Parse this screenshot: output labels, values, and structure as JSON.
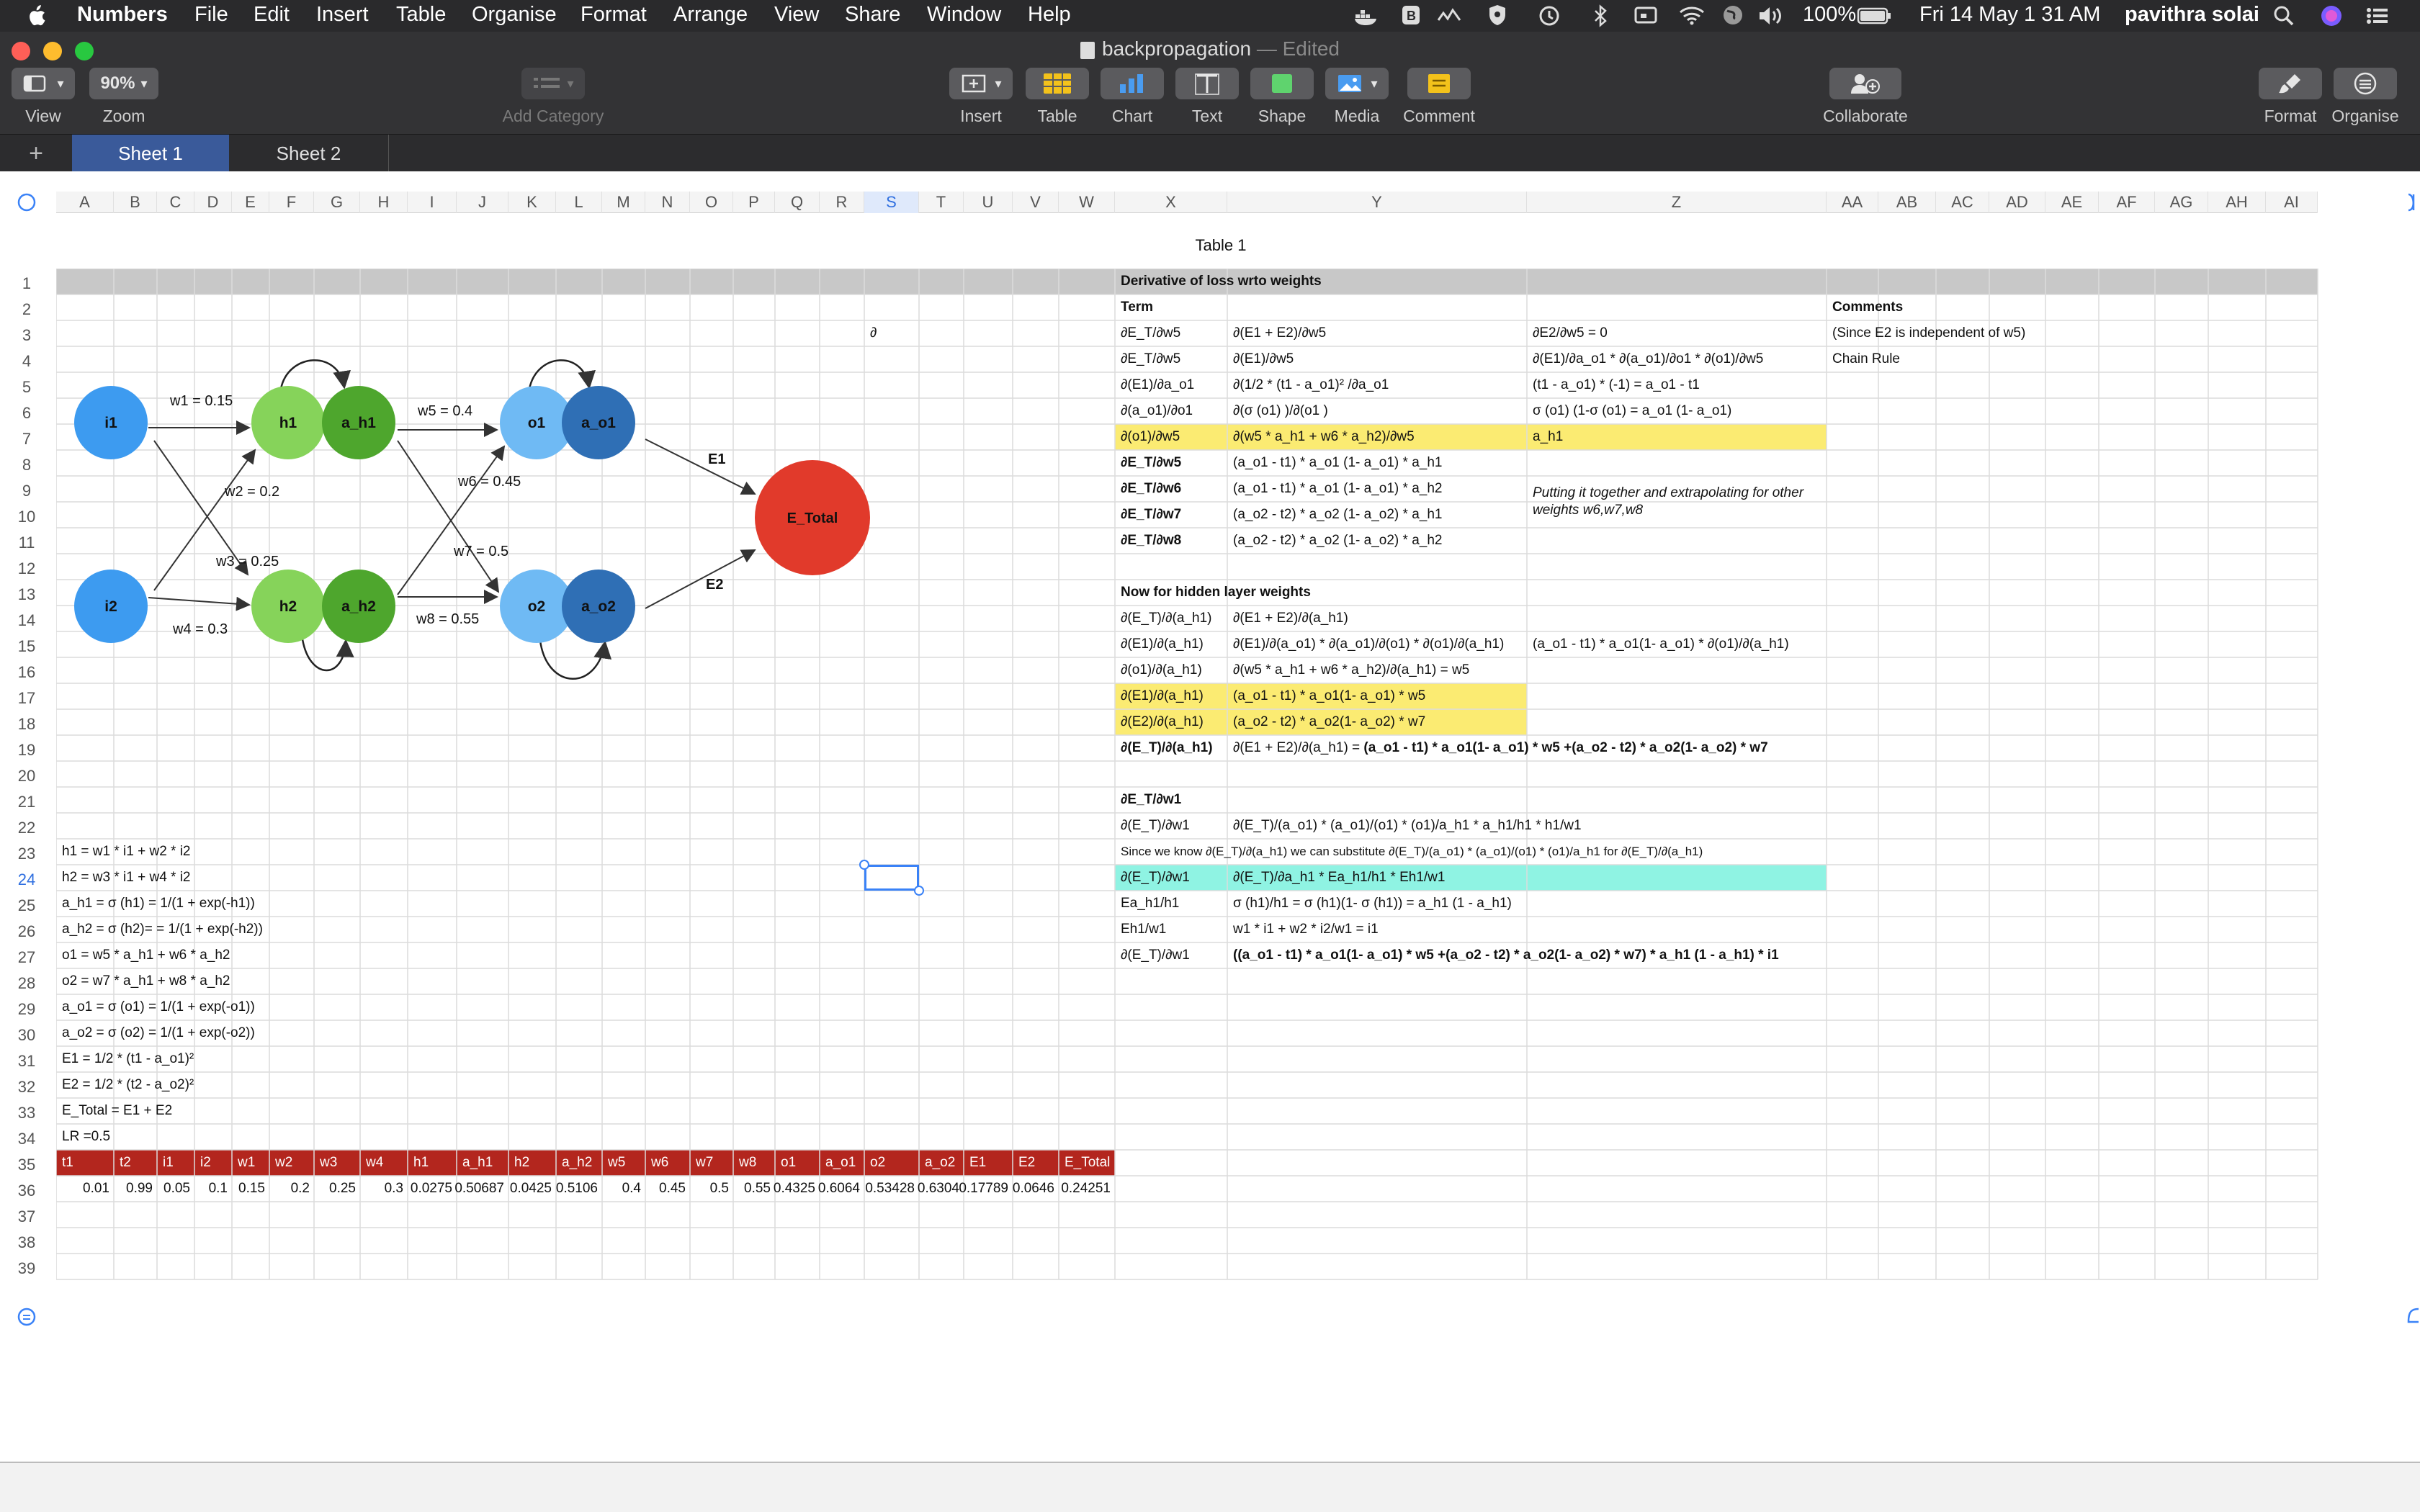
{
  "menubar": {
    "apple": "",
    "items": [
      "Numbers",
      "File",
      "Edit",
      "Insert",
      "Table",
      "Organise",
      "Format",
      "Arrange",
      "View",
      "Share",
      "Window",
      "Help"
    ],
    "battery": "100%",
    "datetime": "Fri 14 May  1 31 AM",
    "user": "pavithra solai"
  },
  "document": {
    "title": "backpropagation",
    "edited": "— Edited"
  },
  "toolbar": {
    "view": "View",
    "zoom": "Zoom",
    "zoom_value": "90%",
    "add_category": "Add Category",
    "insert": "Insert",
    "table": "Table",
    "chart": "Chart",
    "text": "Text",
    "shape": "Shape",
    "media": "Media",
    "comment": "Comment",
    "collaborate": "Collaborate",
    "format": "Format",
    "organise": "Organise"
  },
  "sheets": {
    "add": "+",
    "tabs": [
      "Sheet 1",
      "Sheet 2"
    ],
    "active": 0
  },
  "table": {
    "title": "Table 1",
    "columns": [
      "A",
      "B",
      "C",
      "D",
      "E",
      "F",
      "G",
      "H",
      "I",
      "J",
      "K",
      "L",
      "M",
      "N",
      "O",
      "P",
      "Q",
      "R",
      "S",
      "T",
      "U",
      "V",
      "W",
      "X",
      "Y",
      "Z",
      "AA",
      "AB",
      "AC",
      "AD",
      "AE",
      "AF",
      "AG",
      "AH",
      "AI"
    ],
    "rows": 39,
    "selected_column": "S",
    "selected_row": 24
  },
  "diagram": {
    "nodes": [
      "i1",
      "i2",
      "h1",
      "a_h1",
      "h2",
      "a_h2",
      "o1",
      "a_o1",
      "o2",
      "a_o2",
      "E_Total"
    ],
    "weights": [
      "w1 = 0.15",
      "w2 = 0.2",
      "w3 = 0.25",
      "w4 = 0.3",
      "w5 = 0.4",
      "w6 = 0.45",
      "w7 = 0.5",
      "w8 = 0.55"
    ],
    "errors": [
      "E1",
      "E2"
    ],
    "colors": {
      "input": "#3d9bf0",
      "hidden": "#86d35a",
      "hidden_act": "#4ea62d",
      "output": "#6fbaf4",
      "output_act": "#2f6fb5",
      "error": "#e13a2b"
    }
  },
  "cells": {
    "s3": "∂",
    "x1": "Derivative of loss wrto weights",
    "x2": "Term",
    "aa2": "Comments",
    "x3": "∂E_T/∂w5",
    "y3": "∂(E1 + E2)/∂w5",
    "z3": "∂E2/∂w5 = 0",
    "aa3": "(Since E2 is independent of w5)",
    "x4": "∂E_T/∂w5",
    "y4": "∂(E1)/∂w5",
    "z4": "∂(E1)/∂a_o1 * ∂(a_o1)/∂o1 * ∂(o1)/∂w5",
    "aa4": "Chain Rule",
    "x5": "∂(E1)/∂a_o1",
    "y5": "∂(1/2 * (t1 - a_o1)² /∂a_o1",
    "z5": "(t1 - a_o1) * (-1) = a_o1 - t1",
    "x6": "∂(a_o1)/∂o1",
    "y6": "∂(σ (o1) )/∂(o1 )",
    "z6": "σ (o1) (1-σ (o1)  = a_o1 (1- a_o1)",
    "x7": "∂(o1)/∂w5",
    "y7": "∂(w5 * a_h1  + w6 * a_h2)/∂w5",
    "z7": "a_h1",
    "x8": "∂E_T/∂w5",
    "y8": "(a_o1 - t1) * a_o1 (1- a_o1) * a_h1",
    "x9": "∂E_T/∂w6",
    "y9": "(a_o1 - t1) * a_o1 (1- a_o1) * a_h2",
    "z9": "Putting it together and extrapolating for other weights w6,w7,w8",
    "x10": "∂E_T/∂w7",
    "y10": "(a_o2 - t2) * a_o2 (1- a_o2) * a_h1",
    "x11": "∂E_T/∂w8",
    "y11": "(a_o2 - t2) * a_o2 (1- a_o2) * a_h2",
    "x13": "Now for hidden layer weights",
    "x14": "∂(E_T)/∂(a_h1)",
    "y14": "∂(E1 + E2)/∂(a_h1)",
    "x15": "∂(E1)/∂(a_h1)",
    "y15": "∂(E1)/∂(a_o1) * ∂(a_o1)/∂(o1) * ∂(o1)/∂(a_h1)",
    "z15": "(a_o1 - t1) * a_o1(1- a_o1) * ∂(o1)/∂(a_h1)",
    "x16": "∂(o1)/∂(a_h1)",
    "y16": "∂(w5 * a_h1  + w6 * a_h2)/∂(a_h1) = w5",
    "x17": "∂(E1)/∂(a_h1)",
    "y17": "(a_o1 - t1) * a_o1(1- a_o1) * w5",
    "x18": "∂(E2)/∂(a_h1)",
    "y18": "(a_o2 - t2) * a_o2(1- a_o2) * w7",
    "x19": "∂(E_T)/∂(a_h1)",
    "y19a": "∂(E1 + E2)/∂(a_h1) = ",
    "y19b": "(a_o1 - t1) * a_o1(1- a_o1) * w5 +(a_o2 - t2) * a_o2(1- a_o2) * w7",
    "x21": "∂E_T/∂w1",
    "x22": "∂(E_T)/∂w1",
    "y22": "∂(E_T)/(a_o1) *  (a_o1)/(o1)  * (o1)/a_h1 * a_h1/h1 * h1/w1",
    "x23": "Since we know ∂(E_T)/∂(a_h1) we can substitute ∂(E_T)/(a_o1) *  (a_o1)/(o1)  * (o1)/a_h1  for ∂(E_T)/∂(a_h1)",
    "x24": "∂(E_T)/∂w1",
    "y24": "∂(E_T)/∂a_h1 * Ea_h1/h1 * Eh1/w1",
    "x25": "Ea_h1/h1",
    "y25": "σ (h1)/h1 = σ (h1)(1- σ (h1)) = a_h1 (1 - a_h1)",
    "x26": "Eh1/w1",
    "y26": "w1 * i1 + w2 * i2/w1 = i1",
    "x27": "∂(E_T)/∂w1",
    "y27": "((a_o1 - t1) * a_o1(1- a_o1) * w5 +(a_o2 - t2) * a_o2(1- a_o2) * w7) * a_h1 (1 - a_h1) * i1",
    "a23": "h1 = w1 * i1 + w2 * i2",
    "a24": "h2 = w3 * i1 + w4 * i2",
    "a25": "a_h1 = σ (h1) = 1/(1 + exp(-h1))",
    "a26": "a_h2 = σ (h2)= = 1/(1 + exp(-h2))",
    "a27": "o1 = w5 * a_h1  + w6 * a_h2",
    "a28": "o2 = w7 * a_h1  + w8 * a_h2",
    "a29": "a_o1 = σ (o1) = 1/(1 + exp(-o1))",
    "a30": "a_o2 = σ (o2) = 1/(1 + exp(-o2))",
    "a31": "E1 = 1/2 * (t1 - a_o1)²",
    "a32": "E2 = 1/2 * (t2 - a_o2)²",
    "a33": "E_Total = E1 + E2",
    "a34": "LR =0.5"
  },
  "value_table": {
    "headers": [
      "t1",
      "t2",
      "i1",
      "i2",
      "w1",
      "w2",
      "w3",
      "w4",
      "h1",
      "a_h1",
      "h2",
      "a_h2",
      "w5",
      "w6",
      "w7",
      "w8",
      "o1",
      "a_o1",
      "o2",
      "a_o2",
      "E1",
      "E2",
      "E_Total"
    ],
    "values": [
      "0.01",
      "0.99",
      "0.05",
      "0.1",
      "0.15",
      "0.2",
      "0.25",
      "0.3",
      "0.0275",
      "0.50687",
      "0.0425",
      "0.5106",
      "0.4",
      "0.45",
      "0.5",
      "0.55",
      "0.4325",
      "0.6064",
      "0.53428",
      "0.6304",
      "0.17789",
      "0.0646",
      "0.24251"
    ],
    "header_color": "#b3261e"
  },
  "highlights": {
    "yellow": "#fbeb72",
    "cyan": "#8ff3e3",
    "header_gray": "#c8c8c8"
  }
}
